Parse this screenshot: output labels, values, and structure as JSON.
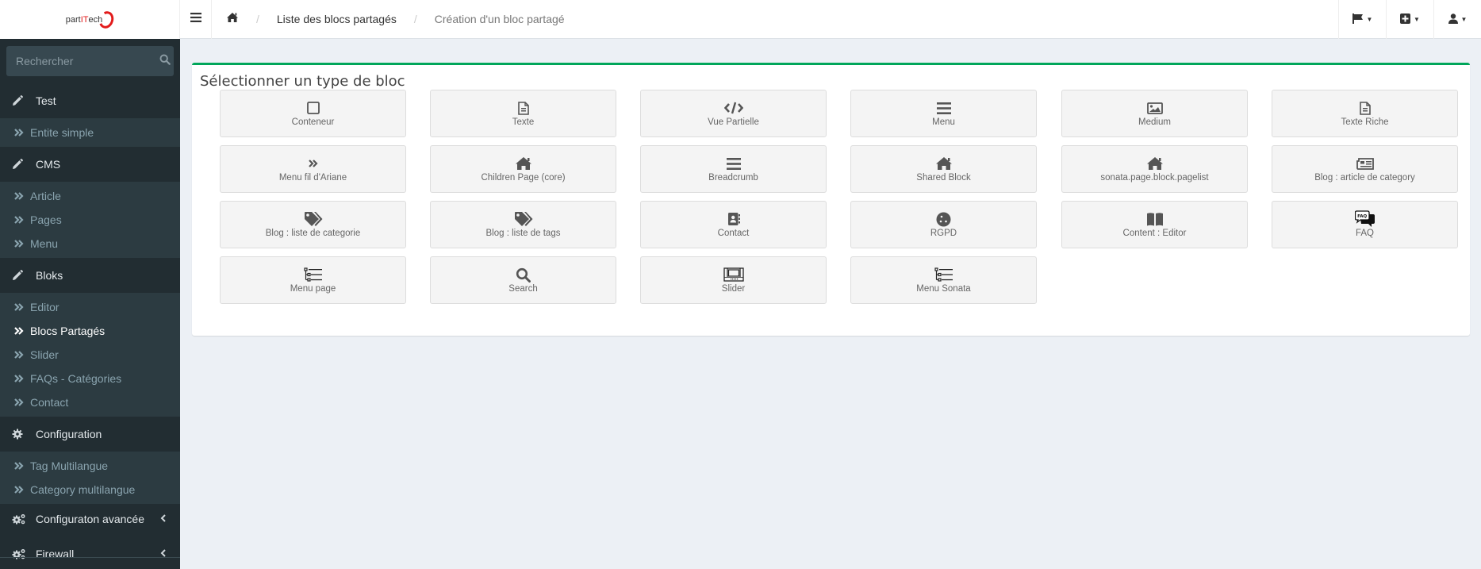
{
  "logo": {
    "prefix": "part",
    "highlight": "IT",
    "suffix": "ech"
  },
  "search": {
    "placeholder": "Rechercher"
  },
  "sidebar": {
    "groups": [
      {
        "label": "Test",
        "icon": "pencil-icon",
        "items": [
          {
            "label": "Entite simple"
          }
        ]
      },
      {
        "label": "CMS",
        "icon": "pencil-icon",
        "items": [
          {
            "label": "Article"
          },
          {
            "label": "Pages"
          },
          {
            "label": "Menu"
          }
        ]
      },
      {
        "label": "Bloks",
        "icon": "pencil-icon",
        "items": [
          {
            "label": "Editor"
          },
          {
            "label": "Blocs Partagés",
            "active": true
          },
          {
            "label": "Slider"
          },
          {
            "label": "FAQs - Catégories"
          },
          {
            "label": "Contact"
          }
        ]
      },
      {
        "label": "Configuration",
        "icon": "gear-icon",
        "items": [
          {
            "label": "Tag Multilangue"
          },
          {
            "label": "Category multilangue"
          }
        ]
      },
      {
        "label": "Configuraton avancée",
        "icon": "gears-icon",
        "collapsed": true
      },
      {
        "label": "Firewall",
        "icon": "gears-icon",
        "collapsed": true
      }
    ]
  },
  "breadcrumb": {
    "home_icon": "home-icon",
    "link": "Liste des blocs partagés",
    "current": "Création d'un bloc partagé"
  },
  "topbar": {
    "buttons": [
      {
        "icon": "flag-icon"
      },
      {
        "icon": "plus-square-icon"
      },
      {
        "icon": "user-icon"
      }
    ]
  },
  "main": {
    "title": "Sélectionner un type de bloc",
    "accent_color": "#00a65a",
    "tiles": [
      {
        "label": "Conteneur",
        "icon": "square-icon"
      },
      {
        "label": "Texte",
        "icon": "file-text-icon"
      },
      {
        "label": "Vue Partielle",
        "icon": "code-icon"
      },
      {
        "label": "Menu",
        "icon": "bars-icon"
      },
      {
        "label": "Medium",
        "icon": "image-icon"
      },
      {
        "label": "Texte Riche",
        "icon": "file-text-icon"
      },
      {
        "label": "Menu fil d'Ariane",
        "icon": "angle-double-right-icon"
      },
      {
        "label": "Children Page (core)",
        "icon": "home-icon"
      },
      {
        "label": "Breadcrumb",
        "icon": "bars-icon"
      },
      {
        "label": "Shared Block",
        "icon": "home-icon"
      },
      {
        "label": "sonata.page.block.pagelist",
        "icon": "home-icon"
      },
      {
        "label": "Blog : article de category",
        "icon": "newspaper-icon"
      },
      {
        "label": "Blog : liste de categorie",
        "icon": "tags-icon"
      },
      {
        "label": "Blog : liste de tags",
        "icon": "tags-icon"
      },
      {
        "label": "Contact",
        "icon": "address-book-icon"
      },
      {
        "label": "RGPD",
        "icon": "cookie-icon"
      },
      {
        "label": "Content : Editor",
        "icon": "book-open-icon"
      },
      {
        "label": "FAQ",
        "icon": "faq-icon"
      },
      {
        "label": "Menu page",
        "icon": "tree-list-icon"
      },
      {
        "label": "Search",
        "icon": "search-icon"
      },
      {
        "label": "Slider",
        "icon": "slider-icon"
      },
      {
        "label": "Menu Sonata",
        "icon": "tree-list-icon"
      }
    ]
  }
}
